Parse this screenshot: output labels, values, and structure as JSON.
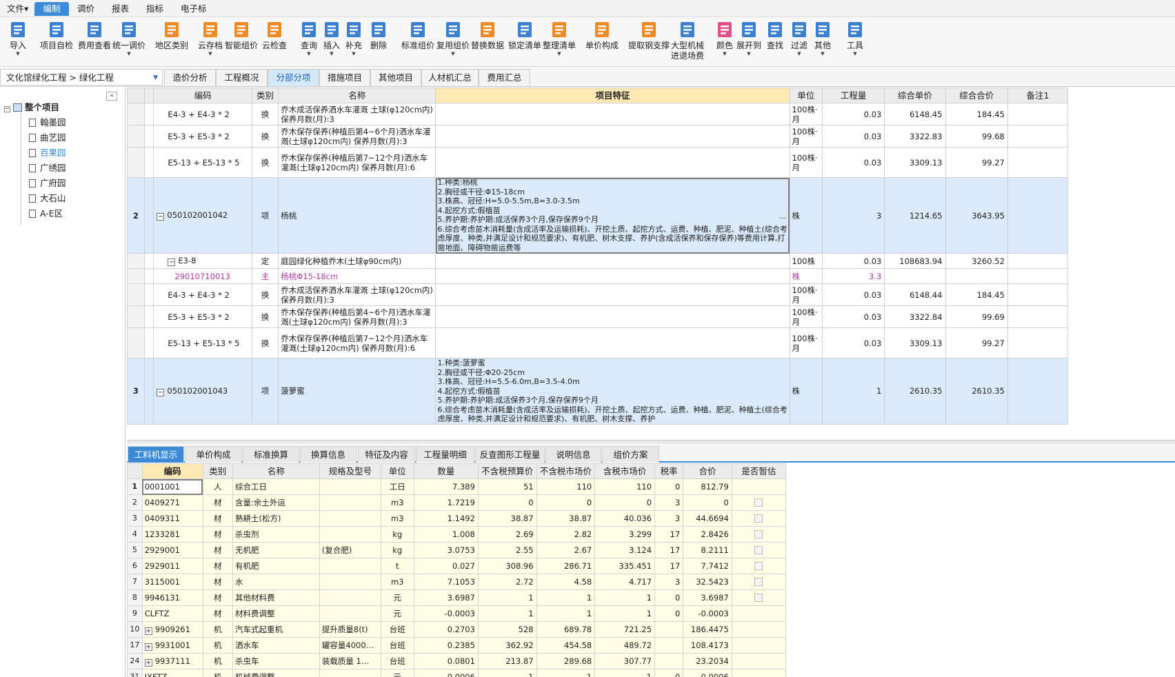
{
  "menu": [
    "文件▾",
    "编制",
    "调价",
    "报表",
    "指标",
    "电子标"
  ],
  "toolbar": {
    "items": [
      {
        "label": "导入",
        "label2": "",
        "icon": "import-icon",
        "arrow": true
      },
      {
        "label": "项目自检",
        "label2": "",
        "icon": "project-check-icon",
        "arrow": false
      },
      {
        "label": "费用查看",
        "label2": "",
        "icon": "cost-view-icon",
        "arrow": false
      },
      {
        "label": "统一调价",
        "label2": "",
        "icon": "unified-price-icon",
        "arrow": true
      },
      {
        "label": "地区类别",
        "label2": "",
        "icon": "region-icon",
        "arrow": false
      },
      {
        "label": "云存档",
        "label2": "",
        "icon": "cloud-archive-icon",
        "arrow": true
      },
      {
        "label": "智能组价",
        "label2": "",
        "icon": "smart-pricing-icon",
        "arrow": false
      },
      {
        "label": "云检查",
        "label2": "",
        "icon": "cloud-check-icon",
        "arrow": false
      },
      {
        "label": "查询",
        "label2": "",
        "icon": "query-icon",
        "arrow": true
      },
      {
        "label": "插入",
        "label2": "",
        "icon": "insert-icon",
        "arrow": true
      },
      {
        "label": "补充",
        "label2": "",
        "icon": "supplement-icon",
        "arrow": true
      },
      {
        "label": "删除",
        "label2": "",
        "icon": "delete-icon",
        "arrow": false
      },
      {
        "label": "标准组价",
        "label2": "",
        "icon": "standard-pricing-icon",
        "arrow": false
      },
      {
        "label": "复用组价",
        "label2": "",
        "icon": "reuse-pricing-icon",
        "arrow": true
      },
      {
        "label": "替换数据",
        "label2": "",
        "icon": "replace-data-icon",
        "arrow": false
      },
      {
        "label": "锁定清单",
        "label2": "",
        "icon": "lock-icon",
        "arrow": false
      },
      {
        "label": "整理清单",
        "label2": "",
        "icon": "organize-list-icon",
        "arrow": true
      },
      {
        "label": "单价构成",
        "label2": "",
        "icon": "price-composition-icon",
        "arrow": false
      },
      {
        "label": "提取钢支撑",
        "label2": "",
        "icon": "steel-support-icon",
        "arrow": false
      },
      {
        "label": "大型机械",
        "label2": "进退场费",
        "icon": "machinery-icon",
        "arrow": false
      },
      {
        "label": "颜色",
        "label2": "",
        "icon": "color-icon",
        "arrow": true
      },
      {
        "label": "展开到",
        "label2": "",
        "icon": "expand-icon",
        "arrow": true
      },
      {
        "label": "查找",
        "label2": "",
        "icon": "find-icon",
        "arrow": false
      },
      {
        "label": "过滤",
        "label2": "",
        "icon": "filter-icon",
        "arrow": true
      },
      {
        "label": "其他",
        "label2": "",
        "icon": "other-icon",
        "arrow": true
      },
      {
        "label": "工具",
        "label2": "",
        "icon": "tools-icon",
        "arrow": true
      }
    ]
  },
  "breadcrumb": "文化馆绿化工程 > 绿化工程",
  "view_tabs": [
    "造价分析",
    "工程概况",
    "分部分项",
    "措施项目",
    "其他项目",
    "人材机汇总",
    "费用汇总"
  ],
  "tree": {
    "root": "整个项目",
    "children": [
      "翰墨园",
      "曲艺园",
      "百果园",
      "广绣园",
      "广府园",
      "大石山",
      "A-E区"
    ]
  },
  "main_table": {
    "headers": [
      "编码",
      "类别",
      "名称",
      "项目特征",
      "单位",
      "工程量",
      "综合单价",
      "综合合价",
      "备注1"
    ],
    "rows": [
      {
        "no": "",
        "code": "E4-3 + E4-3 * 2",
        "type": "换",
        "name": "乔木成活保养洒水车灌溉 土球(φ120cm内) 保养月数(月):3",
        "feature": "",
        "unit": "100株·月",
        "qty": "0.03",
        "price": "6148.45",
        "total": "184.45",
        "note": ""
      },
      {
        "no": "",
        "code": "E5-3 + E5-3 * 2",
        "type": "换",
        "name": "乔木保存保养(种植后第4~6个月)洒水车灌溉(土球φ120cm内) 保养月数(月):3",
        "feature": "",
        "unit": "100株·月",
        "qty": "0.03",
        "price": "3322.83",
        "total": "99.68",
        "note": ""
      },
      {
        "no": "",
        "code": "E5-13 + E5-13 * 5",
        "type": "换",
        "name": "乔木保存保养(种植后第7~12个月)洒水车灌溉(土球φ120cm内) 保养月数(月):6",
        "feature": "",
        "unit": "100株·月",
        "qty": "0.03",
        "price": "3309.13",
        "total": "99.27",
        "note": ""
      },
      {
        "no": "2",
        "code": "050102001042",
        "type": "项",
        "name": "杨桃",
        "feature": "1.种类:杨桃\n2.胸径或干径:Φ15-18cm\n3.株高、冠径:H=5.0-5.5m,B=3.0-3.5m\n4.起挖方式:假植苗\n5.养护期:养护期:成活保养3个月,保存保养9个月\n6.综合考虑苗木消耗量(含成活率及运输损耗)、开挖土质、起挖方式、运费、种植、肥泥、种植土(综合考虑厚度、种类,并满足设计和规范要求)、有机肥、树木支撑、养护(含成活保养和保存保养)等费用计算,打凿地面、障碍物凿运费等",
        "unit": "株",
        "qty": "3",
        "price": "1214.65",
        "total": "3643.95",
        "note": ""
      },
      {
        "no": "",
        "code": "E3-8",
        "type": "定",
        "name": "庭园绿化种植乔木(土球φ90cm内)",
        "feature": "",
        "unit": "100株",
        "qty": "0.03",
        "price": "108683.94",
        "total": "3260.52",
        "note": ""
      },
      {
        "no": "",
        "code": "29010710013",
        "type": "主",
        "name": "杨桃Φ15-18cm",
        "feature": "",
        "unit": "株",
        "qty": "3.3",
        "price": "",
        "total": "",
        "note": ""
      },
      {
        "no": "",
        "code": "E4-3 + E4-3 * 2",
        "type": "换",
        "name": "乔木成活保养洒水车灌溉 土球(φ120cm内) 保养月数(月):3",
        "feature": "",
        "unit": "100株·月",
        "qty": "0.03",
        "price": "6148.44",
        "total": "184.45",
        "note": ""
      },
      {
        "no": "",
        "code": "E5-3 + E5-3 * 2",
        "type": "换",
        "name": "乔木保存保养(种植后第4~6个月)洒水车灌溉(土球φ120cm内) 保养月数(月):3",
        "feature": "",
        "unit": "100株·月",
        "qty": "0.03",
        "price": "3322.84",
        "total": "99.69",
        "note": ""
      },
      {
        "no": "",
        "code": "E5-13 + E5-13 * 5",
        "type": "换",
        "name": "乔木保存保养(种植后第7~12个月)洒水车灌溉(土球φ120cm内) 保养月数(月):6",
        "feature": "",
        "unit": "100株·月",
        "qty": "0.03",
        "price": "3309.13",
        "total": "99.27",
        "note": ""
      },
      {
        "no": "3",
        "code": "050102001043",
        "type": "项",
        "name": "菠萝蜜",
        "feature": "1.种类:菠萝蜜\n2.胸径或干径:Φ20-25cm\n3.株高、冠径:H=5.5-6.0m,B=3.5-4.0m\n4.起挖方式:假植苗\n5.养护期:养护期:成活保养3个月,保存保养9个月\n6.综合考虑苗木消耗量(含成活率及运输损耗)、开挖土质、起挖方式、运费、种植、肥泥、种植土(综合考虑厚度、种类,并满足设计和规范要求)、有机肥、树木支撑、养护",
        "unit": "株",
        "qty": "1",
        "price": "2610.35",
        "total": "2610.35",
        "note": ""
      }
    ]
  },
  "bottom_tabs": [
    "工料机显示",
    "单价构成",
    "标准换算",
    "换算信息",
    "特征及内容",
    "工程量明细",
    "反查图形工程量",
    "说明信息",
    "组价方案"
  ],
  "sub_table": {
    "headers": [
      "编码",
      "类别",
      "名称",
      "规格及型号",
      "单位",
      "数量",
      "不含税预算价",
      "不含税市场价",
      "含税市场价",
      "税率",
      "合价",
      "是否暂估"
    ],
    "rows": [
      {
        "rn": "1",
        "code": "0001001",
        "type": "人",
        "name": "综合工日",
        "spec": "",
        "unit": "工日",
        "qty": "7.389",
        "p1": "51",
        "p2": "110",
        "p3": "110",
        "tax": "0",
        "total": "812.79",
        "est": false,
        "expand": false
      },
      {
        "rn": "2",
        "code": "0409271",
        "type": "材",
        "name": "含量:余土外运",
        "spec": "",
        "unit": "m3",
        "qty": "1.7219",
        "p1": "0",
        "p2": "0",
        "p3": "0",
        "tax": "3",
        "total": "0",
        "est": true,
        "expand": false
      },
      {
        "rn": "3",
        "code": "0409311",
        "type": "材",
        "name": "熟耕土(松方)",
        "spec": "",
        "unit": "m3",
        "qty": "1.1492",
        "p1": "38.87",
        "p2": "38.87",
        "p3": "40.036",
        "tax": "3",
        "total": "44.6694",
        "est": true,
        "expand": false
      },
      {
        "rn": "4",
        "code": "1233281",
        "type": "材",
        "name": "杀虫剂",
        "spec": "",
        "unit": "kg",
        "qty": "1.008",
        "p1": "2.69",
        "p2": "2.82",
        "p3": "3.299",
        "tax": "17",
        "total": "2.8426",
        "est": true,
        "expand": false
      },
      {
        "rn": "5",
        "code": "2929001",
        "type": "材",
        "name": "无机肥",
        "spec": "(复合肥)",
        "unit": "kg",
        "qty": "3.0753",
        "p1": "2.55",
        "p2": "2.67",
        "p3": "3.124",
        "tax": "17",
        "total": "8.2111",
        "est": true,
        "expand": false
      },
      {
        "rn": "6",
        "code": "2929011",
        "type": "材",
        "name": "有机肥",
        "spec": "",
        "unit": "t",
        "qty": "0.027",
        "p1": "308.96",
        "p2": "286.71",
        "p3": "335.451",
        "tax": "17",
        "total": "7.7412",
        "est": true,
        "expand": false
      },
      {
        "rn": "7",
        "code": "3115001",
        "type": "材",
        "name": "水",
        "spec": "",
        "unit": "m3",
        "qty": "7.1053",
        "p1": "2.72",
        "p2": "4.58",
        "p3": "4.717",
        "tax": "3",
        "total": "32.5423",
        "est": true,
        "expand": false
      },
      {
        "rn": "8",
        "code": "9946131",
        "type": "材",
        "name": "其他材料费",
        "spec": "",
        "unit": "元",
        "qty": "3.6987",
        "p1": "1",
        "p2": "1",
        "p3": "1",
        "tax": "0",
        "total": "3.6987",
        "est": true,
        "expand": false
      },
      {
        "rn": "9",
        "code": "CLFTZ",
        "type": "材",
        "name": "材料费调整",
        "spec": "",
        "unit": "元",
        "qty": "-0.0003",
        "p1": "1",
        "p2": "1",
        "p3": "1",
        "tax": "0",
        "total": "-0.0003",
        "est": false,
        "expand": false
      },
      {
        "rn": "10",
        "code": "9909261",
        "type": "机",
        "name": "汽车式起重机",
        "spec": "提升质量8(t)",
        "unit": "台班",
        "qty": "0.2703",
        "p1": "528",
        "p2": "689.78",
        "p3": "721.25",
        "tax": "",
        "total": "186.4475",
        "est": false,
        "expand": true
      },
      {
        "rn": "17",
        "code": "9931001",
        "type": "机",
        "name": "洒水车",
        "spec": "罐容量4000…",
        "unit": "台班",
        "qty": "0.2385",
        "p1": "362.92",
        "p2": "454.58",
        "p3": "489.72",
        "tax": "",
        "total": "108.4173",
        "est": false,
        "expand": true
      },
      {
        "rn": "24",
        "code": "9937111",
        "type": "机",
        "name": "杀虫车",
        "spec": "装载质量 1…",
        "unit": "台班",
        "qty": "0.0801",
        "p1": "213.87",
        "p2": "289.68",
        "p3": "307.77",
        "tax": "",
        "total": "23.2034",
        "est": false,
        "expand": true
      },
      {
        "rn": "31",
        "code": "JXFTZ",
        "type": "机",
        "name": "机械费调整",
        "spec": "",
        "unit": "元",
        "qty": "-0.0006",
        "p1": "1",
        "p2": "1",
        "p3": "1",
        "tax": "0",
        "total": "-0.0006",
        "est": false,
        "expand": false
      }
    ]
  },
  "colors": {
    "accent": "#3b8ad8",
    "highlight_row": "#dbeafb",
    "feature_header": "#fde9b4",
    "material_text": "#b13aa3",
    "sub_bg": "#fffde6"
  }
}
